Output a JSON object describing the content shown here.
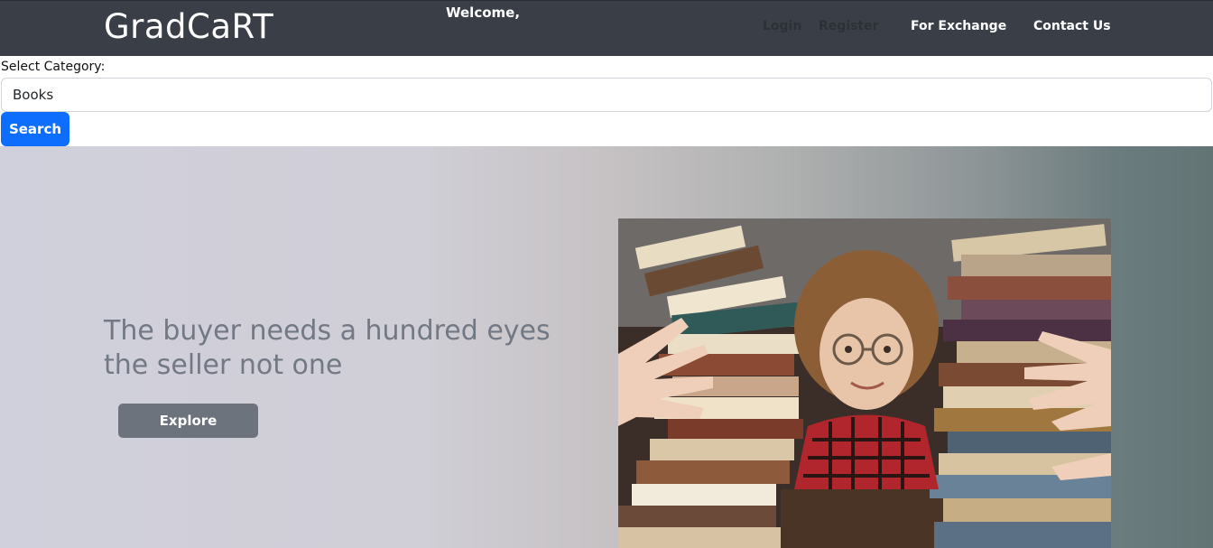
{
  "navbar": {
    "brand": "GradCaRT",
    "welcome": "Welcome,",
    "links": {
      "login": "Login",
      "register": "Register",
      "exchange": "For Exchange",
      "contact": "Contact Us"
    }
  },
  "search": {
    "label": "Select Category:",
    "selected": "Books",
    "button": "Search"
  },
  "hero": {
    "title_line1": "The buyer needs a hundred eyes",
    "title_line2": "the seller not one",
    "button": "Explore",
    "image": "person-with-book-stacks-photo"
  },
  "colors": {
    "navbar_bg": "#3a3f47",
    "primary": "#0d6efd",
    "explore_bg": "#6c737c",
    "hero_text": "#727984"
  }
}
